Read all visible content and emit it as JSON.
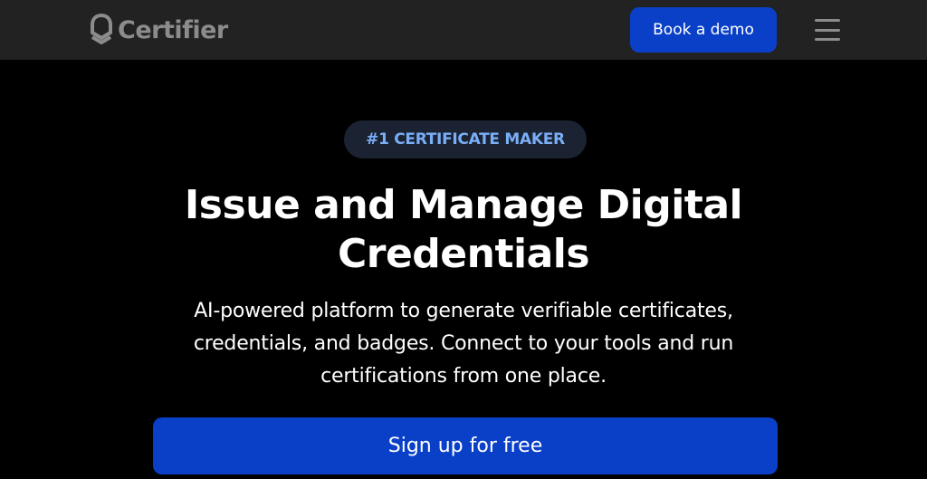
{
  "header": {
    "logo_text": "Certifier",
    "logo_icon": "certifier-shield-icon",
    "demo_button_label": "Book a demo",
    "menu_icon": "hamburger-menu-icon"
  },
  "hero": {
    "badge": "#1 CERTIFICATE MAKER",
    "title_line1": "Issue and Manage Digital",
    "title_line2": "Credentials",
    "subtitle_line1": "AI-powered platform to generate verifiable certificates,",
    "subtitle_line2": "credentials, and badges. Connect to your tools and run",
    "subtitle_line3": "certifications from one place.",
    "cta_label": "Sign up for free"
  },
  "colors": {
    "navbar_bg": "#222222",
    "page_bg": "#000000",
    "accent_blue": "#0a40c8",
    "badge_bg": "#1b2333",
    "badge_text": "#7aaef6",
    "logo_gray": "#8c8c8c"
  }
}
